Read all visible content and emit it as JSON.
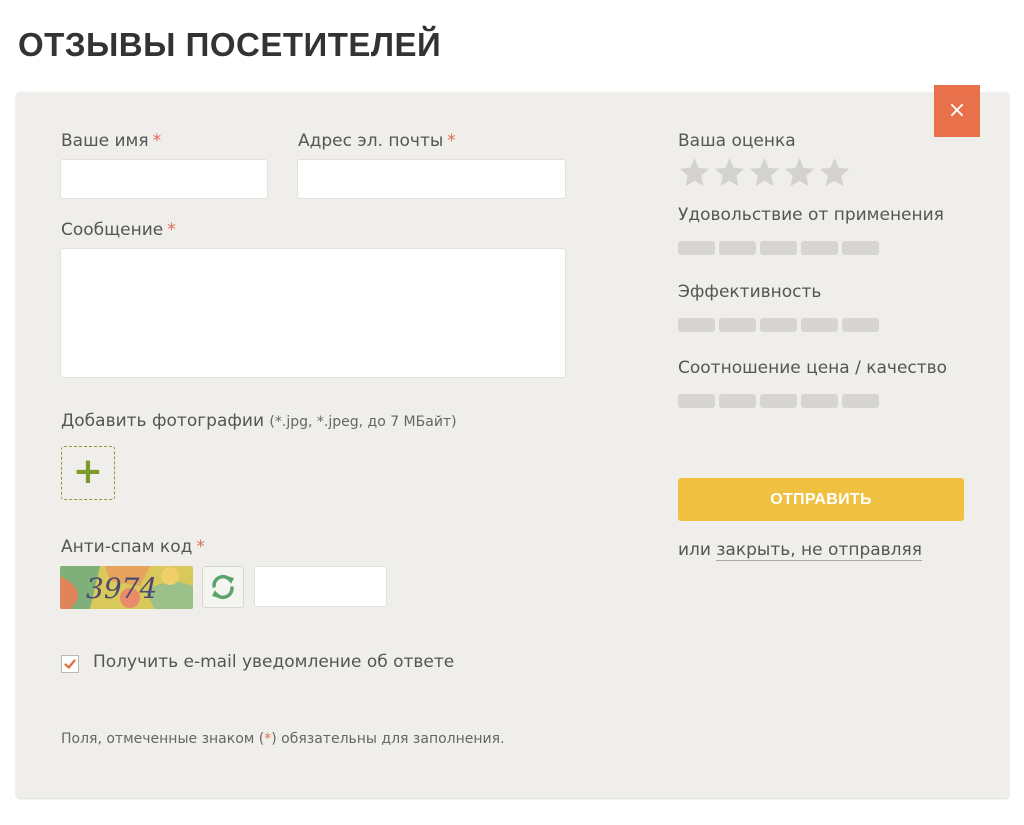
{
  "page": {
    "title": "ОТЗЫВЫ ПОСЕТИТЕЛЕЙ"
  },
  "colors": {
    "accent": "#e8704a",
    "submit": "#f0c040",
    "required": "#e26a55",
    "plus": "#7e9a2c",
    "panel": "#efeeea"
  },
  "form": {
    "close_icon": "×",
    "required_mark": "*",
    "name_label": "Ваше имя",
    "name_value": "",
    "email_label": "Адрес эл. почты",
    "email_value": "",
    "message_label": "Сообщение",
    "message_value": "",
    "photos_label": "Добавить фотографии",
    "photos_hint": "(*.jpg, *.jpeg, до 7 МБайт)",
    "add_photo_icon": "+",
    "antispam_label": "Анти-спам код",
    "captcha_code": "3974",
    "captcha_value": "",
    "notify_label": "Получить e-mail уведомление об ответе",
    "notify_checked": true,
    "footnote_before": "Поля, отмеченные знаком (",
    "footnote_mark": "*",
    "footnote_after": ") обязательны для заполнения."
  },
  "ratings": {
    "overall_label": "Ваша оценка",
    "overall_stars": 0,
    "overall_max": 5,
    "criteria": [
      {
        "label": "Удовольствие от применения",
        "value": 0,
        "max": 5
      },
      {
        "label": "Эффективность",
        "value": 0,
        "max": 5
      },
      {
        "label": "Соотношение цена / качество",
        "value": 0,
        "max": 5
      }
    ]
  },
  "actions": {
    "submit_label": "ОТПРАВИТЬ",
    "close_prefix": "или ",
    "close_link_label": "закрыть, не отправляя"
  }
}
